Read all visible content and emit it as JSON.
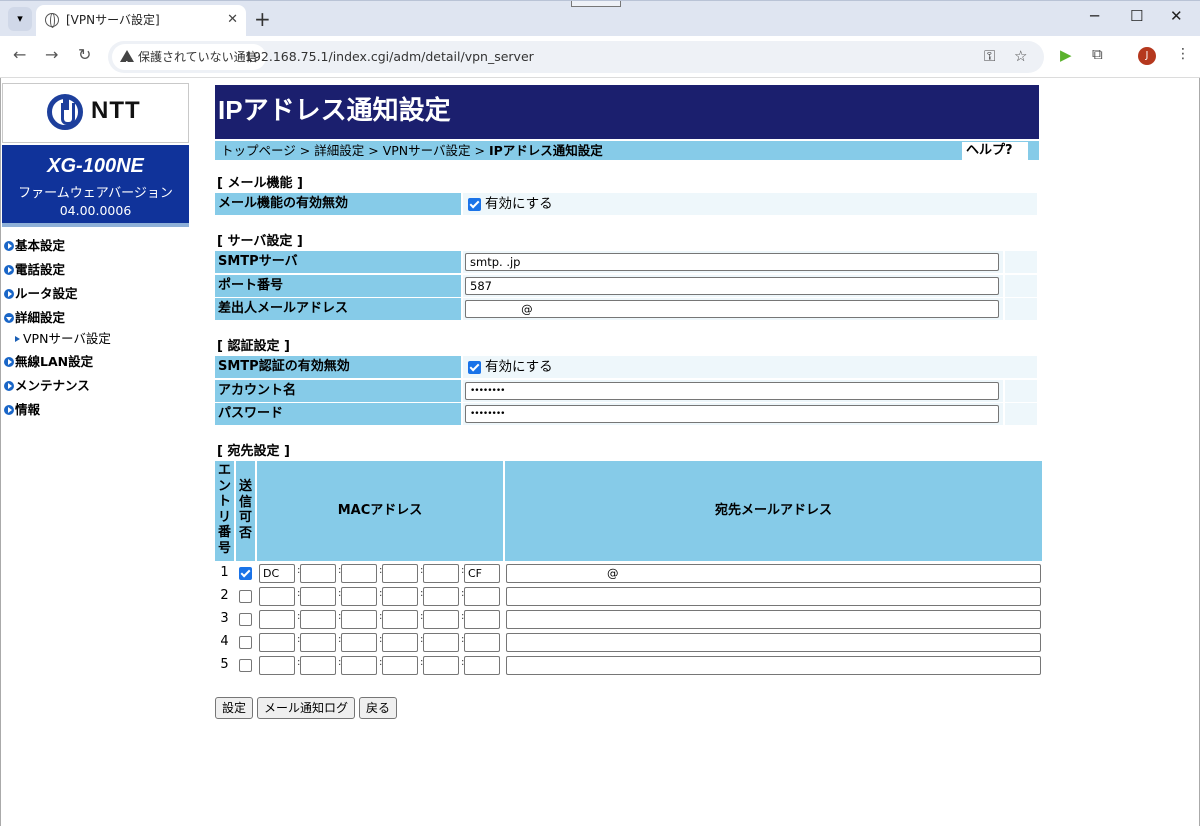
{
  "browser": {
    "tab_title": "[VPNサーバ設定]",
    "tab_close": "✕",
    "new_tab": "+",
    "window_min": "─",
    "window_max": "☐",
    "window_close": "✕",
    "back": "←",
    "forward": "→",
    "reload": "↻",
    "security_label": "保護されていない通信",
    "url": "192.168.75.1/index.cgi/adm/detail/vpn_server",
    "avatar_letter": "J",
    "icons": [
      "globe-icon",
      "warning-icon",
      "key-icon",
      "star-icon",
      "extension-icon",
      "puzzle-icon",
      "kebab-menu-icon"
    ]
  },
  "brand": {
    "logo_text": "NTT",
    "model": "XG-100NE",
    "firmware_label": "ファームウェアバージョン",
    "firmware_version": "04.00.0006"
  },
  "sidebar": {
    "items": [
      {
        "label": "基本設定"
      },
      {
        "label": "電話設定"
      },
      {
        "label": "ルータ設定"
      },
      {
        "label": "詳細設定"
      },
      {
        "label": "無線LAN設定"
      },
      {
        "label": "メンテナンス"
      },
      {
        "label": "情報"
      }
    ],
    "sub_item": "VPNサーバ設定"
  },
  "page": {
    "title": "IPアドレス通知設定",
    "breadcrumb": [
      "トップページ",
      "詳細設定",
      "VPNサーバ設定",
      "IPアドレス通知設定"
    ],
    "breadcrumb_sep": ">",
    "help": "ヘルプ?"
  },
  "mail_section": {
    "heading": "[ メール機能 ]",
    "enable_label": "メール機能の有効無効",
    "enable_option": "有効にする",
    "enabled": true
  },
  "server_section": {
    "heading": "[ サーバ設定 ]",
    "smtp_label": "SMTPサーバ",
    "smtp_value": "smtp.                    .jp",
    "port_label": "ポート番号",
    "port_value": "587",
    "sender_label": "差出人メールアドレス",
    "sender_value": "              @"
  },
  "auth_section": {
    "heading": "[ 認証設定 ]",
    "smtp_auth_label": "SMTP認証の有効無効",
    "smtp_auth_option": "有効にする",
    "smtp_auth_enabled": true,
    "account_label": "アカウント名",
    "account_value": "••••••••",
    "password_label": "パスワード",
    "password_value": "••••••••"
  },
  "dest_section": {
    "heading": "[ 宛先設定 ]",
    "col_entry": "エントリ番号",
    "col_send": "送信可否",
    "col_mac": "MACアドレス",
    "col_mail": "宛先メールアドレス",
    "rows": [
      {
        "num": "1",
        "send": true,
        "mac": [
          "DC",
          "",
          "",
          "",
          "",
          "CF"
        ],
        "mail": "@"
      },
      {
        "num": "2",
        "send": false,
        "mac": [
          "",
          "",
          "",
          "",
          "",
          ""
        ],
        "mail": ""
      },
      {
        "num": "3",
        "send": false,
        "mac": [
          "",
          "",
          "",
          "",
          "",
          ""
        ],
        "mail": ""
      },
      {
        "num": "4",
        "send": false,
        "mac": [
          "",
          "",
          "",
          "",
          "",
          ""
        ],
        "mail": ""
      },
      {
        "num": "5",
        "send": false,
        "mac": [
          "",
          "",
          "",
          "",
          "",
          ""
        ],
        "mail": ""
      }
    ],
    "mac_sep": ":"
  },
  "buttons": {
    "apply": "設定",
    "mail_log": "メール通知ログ",
    "back": "戻る"
  },
  "colors": {
    "title_bg": "#1b1f6e",
    "label_bg": "#86cbe8",
    "model_bg": "#10339a",
    "checkbox_on": "#1a73e8"
  }
}
